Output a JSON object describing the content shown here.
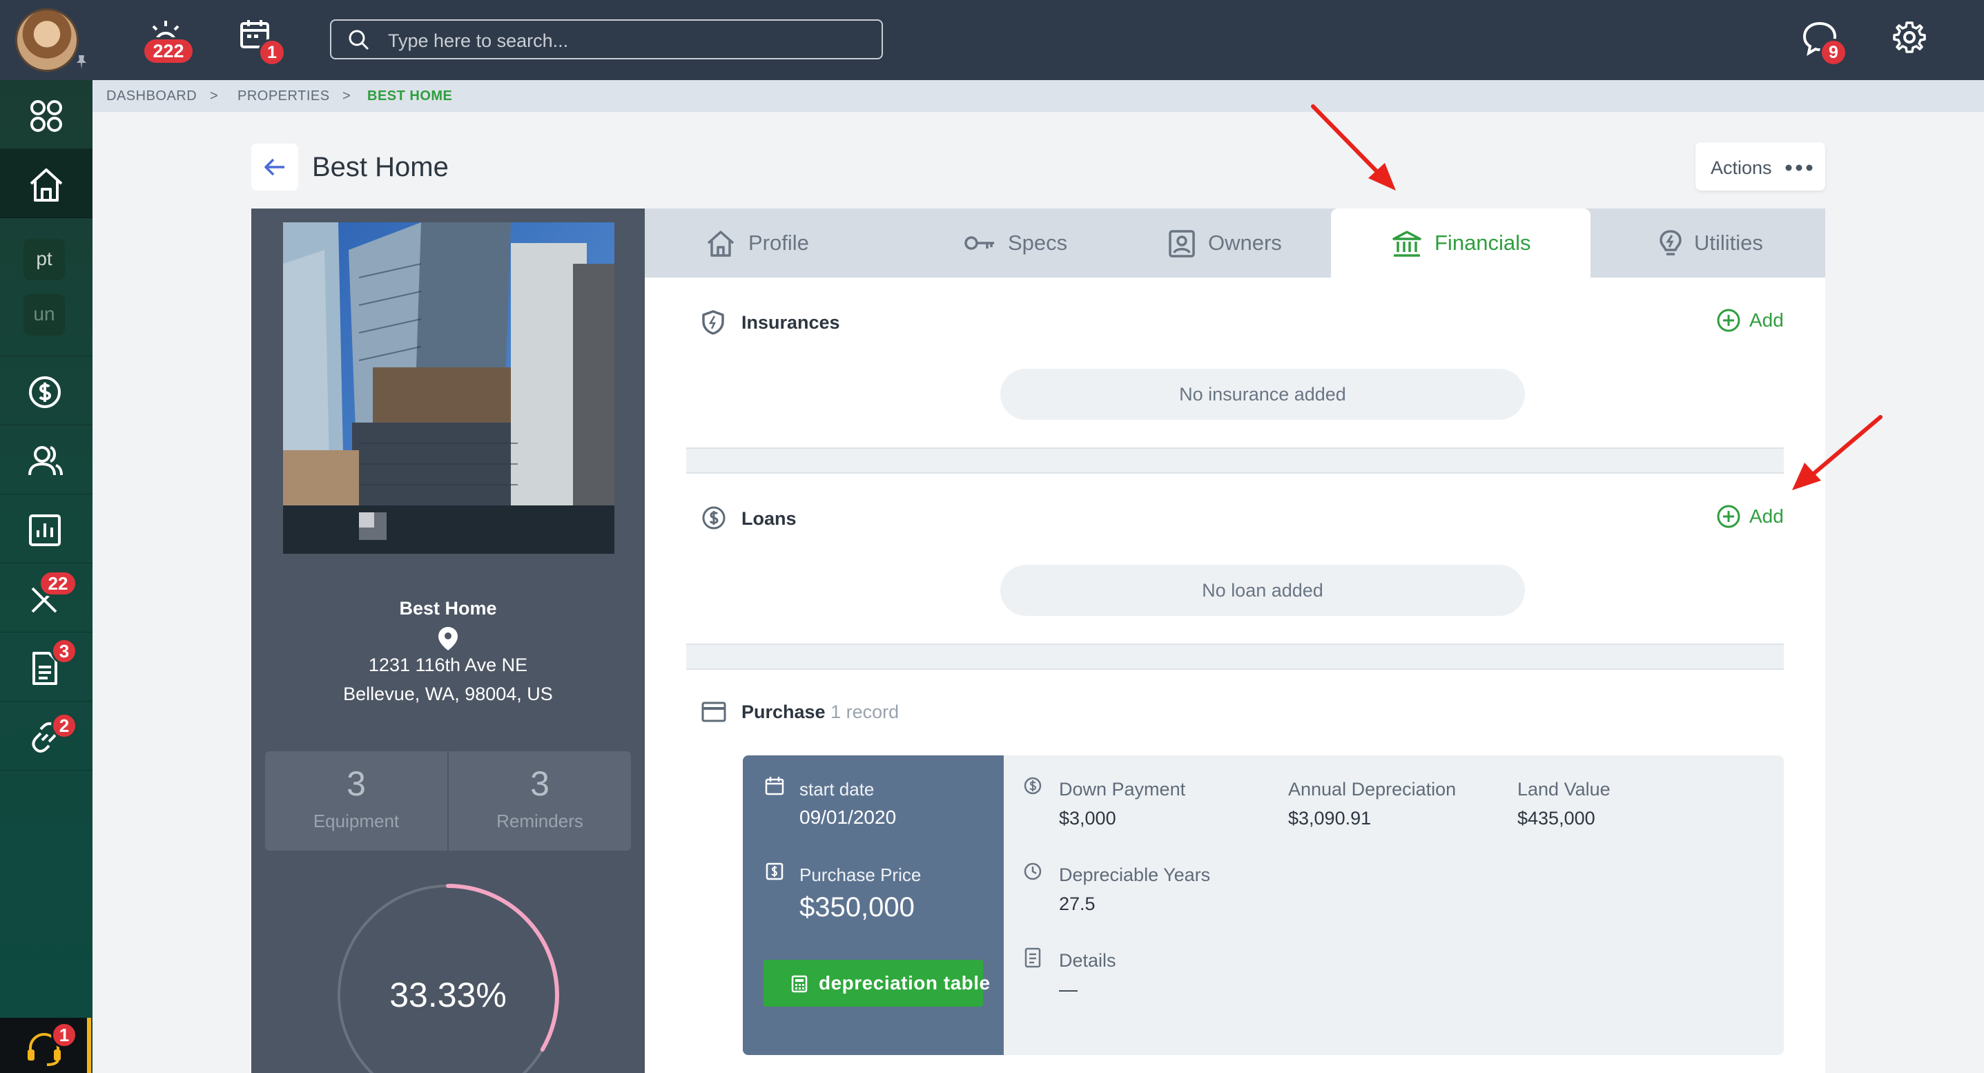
{
  "topbar": {
    "alerts_count": "222",
    "calendar_count": "1",
    "search_placeholder": "Type here to search...",
    "chat_count": "9"
  },
  "rail": {
    "chip_pt": "pt",
    "chip_un": "un",
    "tools_count": "22",
    "docs_count": "3",
    "links_count": "2",
    "help_count": "1"
  },
  "breadcrumb": {
    "items": [
      "DASHBOARD",
      "PROPERTIES",
      "BEST HOME"
    ],
    "separator": ">"
  },
  "header": {
    "title": "Best Home",
    "actions_label": "Actions"
  },
  "property": {
    "name": "Best Home",
    "address_line1": "1231 116th Ave NE",
    "address_line2": "Bellevue, WA, 98004, US",
    "equipment_count": "3",
    "equipment_label": "Equipment",
    "reminders_count": "3",
    "reminders_label": "Reminders",
    "completion": "33.33%",
    "completion_fraction": 0.3333
  },
  "tabs": [
    {
      "label": "Profile",
      "icon": "home-icon"
    },
    {
      "label": "Specs",
      "icon": "key-icon"
    },
    {
      "label": "Owners",
      "icon": "owner-card-icon"
    },
    {
      "label": "Financials",
      "icon": "bank-icon",
      "active": true
    },
    {
      "label": "Utilities",
      "icon": "lightbulb-icon"
    }
  ],
  "financials": {
    "insurances": {
      "title": "Insurances",
      "add_label": "Add",
      "empty_text": "No insurance added"
    },
    "loans": {
      "title": "Loans",
      "add_label": "Add",
      "empty_text": "No loan added"
    },
    "purchase": {
      "title": "Purchase",
      "record_count": "1 record",
      "start_date_label": "start date",
      "start_date": "09/01/2020",
      "price_label": "Purchase Price",
      "price": "$350,000",
      "depreciation_button": "depreciation table",
      "down_payment_label": "Down Payment",
      "down_payment": "$3,000",
      "annual_depreciation_label": "Annual Depreciation",
      "annual_depreciation": "$3,090.91",
      "land_value_label": "Land Value",
      "land_value": "$435,000",
      "depreciable_years_label": "Depreciable Years",
      "depreciable_years": "27.5",
      "details_label": "Details",
      "details": "—"
    }
  },
  "colors": {
    "accent_green": "#2f9e3f",
    "badge_red": "#e0343c",
    "topbar": "#2f3b4a",
    "annotation_arrow": "#e8221b"
  }
}
